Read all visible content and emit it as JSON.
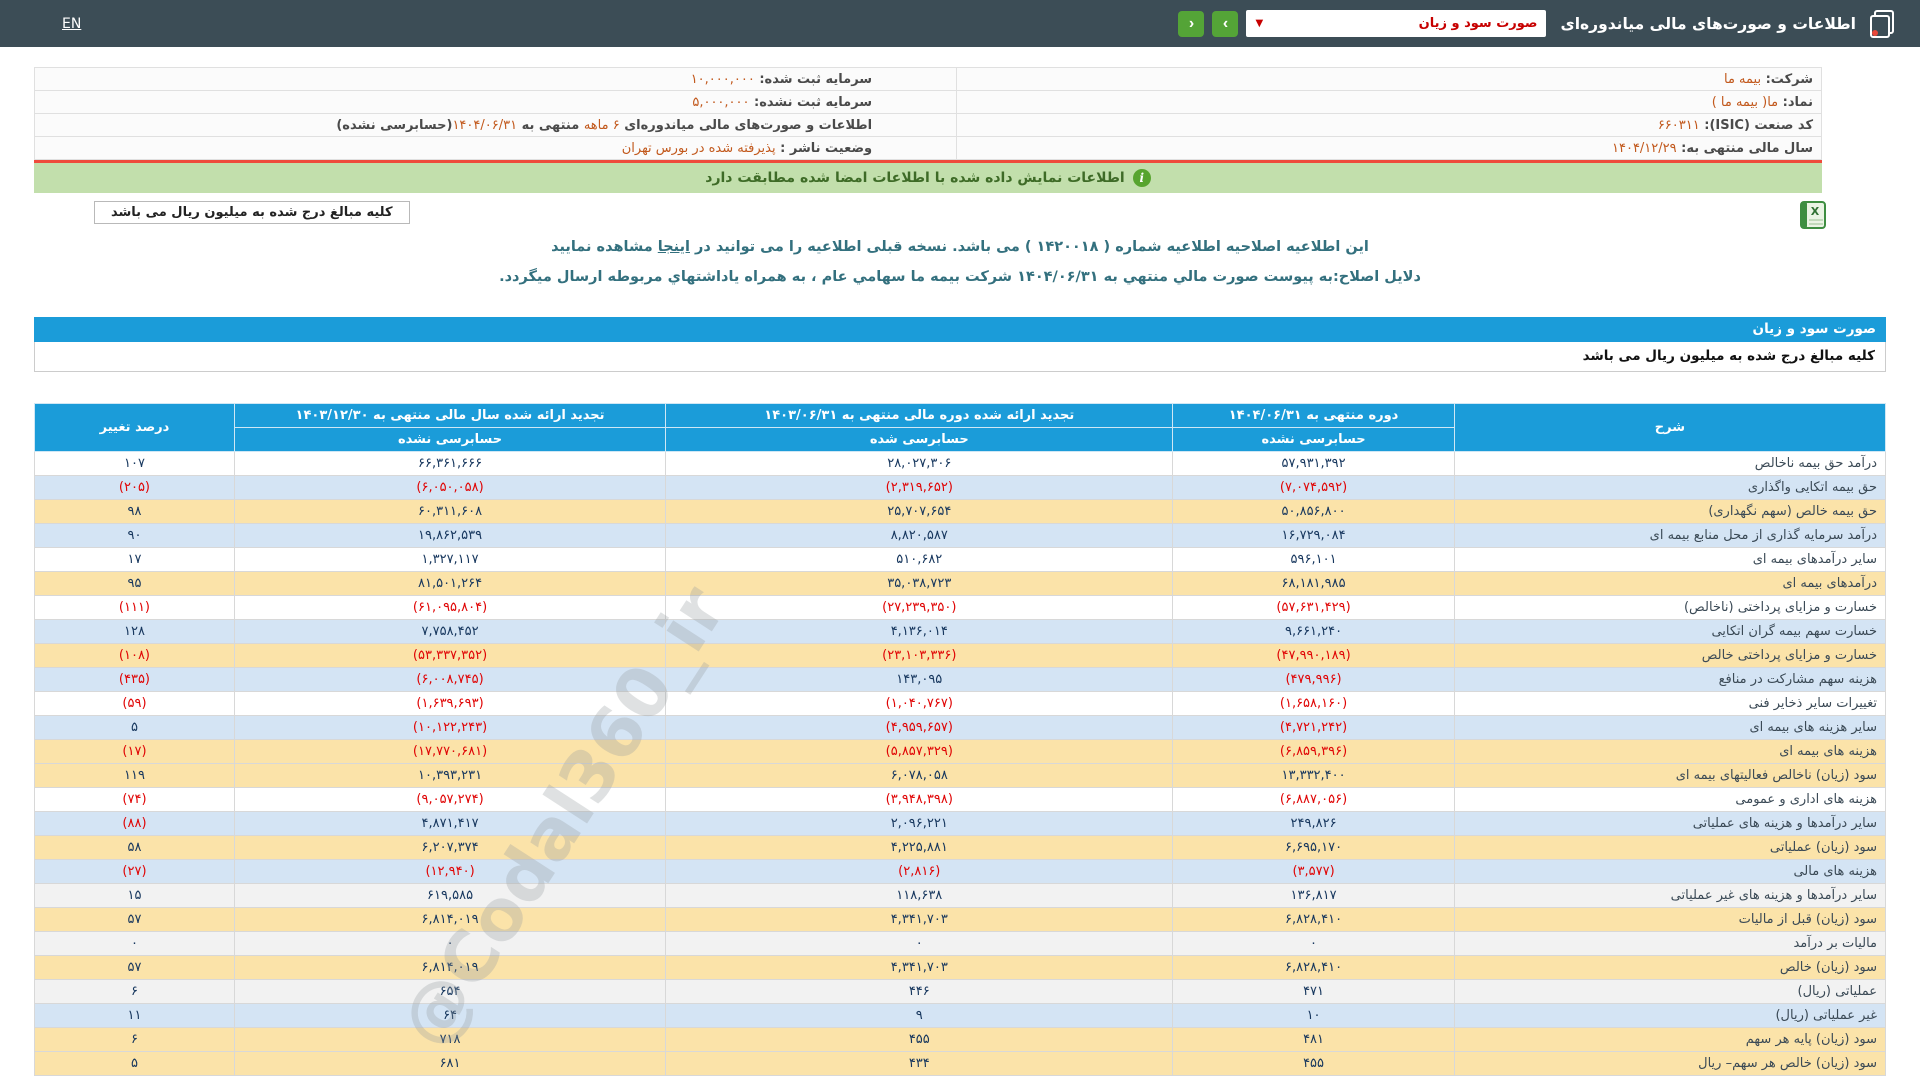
{
  "navbar": {
    "title": "اطلاعات و صورت‌های مالی میاندوره‌ای",
    "report_dropdown_value": "صورت سود و زیان",
    "prev_button": "‹",
    "next_button": "›",
    "lang_link": "EN"
  },
  "company": {
    "rows": [
      {
        "right": {
          "segments": [
            {
              "text": "شرکت:  ",
              "hl": false
            },
            {
              "text": "بیمه ما",
              "hl": true
            }
          ]
        },
        "left": {
          "segments": [
            {
              "text": "سرمایه ثبت شده:  ",
              "hl": false
            },
            {
              "text": "۱۰,۰۰۰,۰۰۰",
              "hl": true
            }
          ]
        }
      },
      {
        "right": {
          "segments": [
            {
              "text": "نماد:  ",
              "hl": false
            },
            {
              "text": "ما( بیمه ما )",
              "hl": true
            }
          ]
        },
        "left": {
          "segments": [
            {
              "text": "سرمایه ثبت نشده:  ",
              "hl": false
            },
            {
              "text": "۵,۰۰۰,۰۰۰",
              "hl": true
            }
          ]
        }
      },
      {
        "right": {
          "segments": [
            {
              "text": "کد صنعت (ISIC):  ",
              "hl": false
            },
            {
              "text": "۶۶۰۳۱۱",
              "hl": true
            }
          ]
        },
        "left": {
          "segments": [
            {
              "text": "اطلاعات و صورت‌های مالی میاندوره‌ای ",
              "hl": false
            },
            {
              "text": "۶ ماهه",
              "hl": true
            },
            {
              "text": " منتهی به ",
              "hl": false
            },
            {
              "text": "۱۴۰۴/۰۶/۳۱",
              "hl": true
            },
            {
              "text": "(حسابرسی نشده)",
              "hl": false
            }
          ]
        }
      },
      {
        "right": {
          "segments": [
            {
              "text": "سال مالی منتهی به:  ",
              "hl": false
            },
            {
              "text": "۱۴۰۴/۱۲/۲۹",
              "hl": true
            }
          ]
        },
        "left": {
          "segments": [
            {
              "text": "وضعیت ناشر :  ",
              "hl": false
            },
            {
              "text": "پذیرفته شده در بورس تهران",
              "hl": true
            }
          ]
        }
      }
    ]
  },
  "signed_notice": "اطلاعات نمایش داده شده با اطلاعات امضا شده مطابقت دارد",
  "unit_note": "کلیه مبالغ درج شده به میلیون ریال می باشد",
  "amendment": {
    "line1_pre": "این اطلاعیه اصلاحیه اطلاعیه شماره ( ۱۴۲۰۰۱۸ ) می باشد. نسخه قبلی اطلاعیه را می توانید در ",
    "line1_link": "اینجا",
    "line1_post": " مشاهده نمایید",
    "line2": "دلایل اصلاح:به پیوست صورت مالي منتهي به ۱۴۰۴/۰۶/۳۱ شرکت بیمه ما سهامي عام ، به همراه یاداشتهاي مربوطه ارسال میگردد."
  },
  "section_title": "صورت سود و زیان",
  "income_statement": {
    "headers": {
      "sharh": "شرح",
      "current": {
        "line1": "دوره منتهی به ۱۴۰۴/۰۶/۳۱",
        "line2": "حسابرسی نشده"
      },
      "prior_period": {
        "line1": "تجدید ارائه شده دوره مالی منتهی به ۱۴۰۳/۰۶/۳۱",
        "line2": "حسابرسی شده"
      },
      "prior_year": {
        "line1": "تجدید ارائه شده سال مالی منتهی به ۱۴۰۳/۱۲/۳۰",
        "line2": "حسابرسی نشده"
      },
      "change_pct": "درصد تغییر"
    },
    "rows": [
      {
        "label": "درآمد حق بیمه ناخالص",
        "current": "۵۷,۹۳۱,۳۹۲",
        "prior_period": "۲۸,۰۲۷,۳۰۶",
        "prior_year": "۶۶,۳۶۱,۶۶۶",
        "change_pct": "۱۰۷",
        "tone": "white"
      },
      {
        "label": "حق بیمه اتکایی واگذاری",
        "current": "(۷,۰۷۴,۵۹۲)",
        "prior_period": "(۲,۳۱۹,۶۵۲)",
        "prior_year": "(۶,۰۵۰,۰۵۸)",
        "change_pct": "(۲۰۵)",
        "tone": "blue"
      },
      {
        "label": "حق بیمه خالص (سهم نگهداری)",
        "current": "۵۰,۸۵۶,۸۰۰",
        "prior_period": "۲۵,۷۰۷,۶۵۴",
        "prior_year": "۶۰,۳۱۱,۶۰۸",
        "change_pct": "۹۸",
        "tone": "yellow"
      },
      {
        "label": "درآمد سرمایه گذاری از محل منابع بیمه ای",
        "current": "۱۶,۷۲۹,۰۸۴",
        "prior_period": "۸,۸۲۰,۵۸۷",
        "prior_year": "۱۹,۸۶۲,۵۳۹",
        "change_pct": "۹۰",
        "tone": "blue"
      },
      {
        "label": "سایر درآمدهای بیمه ای",
        "current": "۵۹۶,۱۰۱",
        "prior_period": "۵۱۰,۶۸۲",
        "prior_year": "۱,۳۲۷,۱۱۷",
        "change_pct": "۱۷",
        "tone": "white"
      },
      {
        "label": "درآمدهای بیمه ای",
        "current": "۶۸,۱۸۱,۹۸۵",
        "prior_period": "۳۵,۰۳۸,۷۲۳",
        "prior_year": "۸۱,۵۰۱,۲۶۴",
        "change_pct": "۹۵",
        "tone": "yellow"
      },
      {
        "label": "خسارت و مزایای پرداختی (ناخالص)",
        "current": "(۵۷,۶۳۱,۴۲۹)",
        "prior_period": "(۲۷,۲۳۹,۳۵۰)",
        "prior_year": "(۶۱,۰۹۵,۸۰۴)",
        "change_pct": "(۱۱۱)",
        "tone": "white"
      },
      {
        "label": "خسارت سهم بیمه گران اتکایی",
        "current": "۹,۶۶۱,۲۴۰",
        "prior_period": "۴,۱۳۶,۰۱۴",
        "prior_year": "۷,۷۵۸,۴۵۲",
        "change_pct": "۱۲۸",
        "tone": "blue"
      },
      {
        "label": "خسارت و مزایای پرداختی خالص",
        "current": "(۴۷,۹۹۰,۱۸۹)",
        "prior_period": "(۲۳,۱۰۳,۳۳۶)",
        "prior_year": "(۵۳,۳۳۷,۳۵۲)",
        "change_pct": "(۱۰۸)",
        "tone": "yellow"
      },
      {
        "label": "هزینه سهم مشارکت در منافع",
        "current": "(۴۷۹,۹۹۶)",
        "prior_period": "۱۴۳,۰۹۵",
        "prior_year": "(۶,۰۰۸,۷۴۵)",
        "change_pct": "(۴۳۵)",
        "tone": "blue"
      },
      {
        "label": "تغییرات سایر ذخایر فنی",
        "current": "(۱,۶۵۸,۱۶۰)",
        "prior_period": "(۱,۰۴۰,۷۶۷)",
        "prior_year": "(۱,۶۳۹,۶۹۳)",
        "change_pct": "(۵۹)",
        "tone": "white"
      },
      {
        "label": "سایر هزینه های بیمه ای",
        "current": "(۴,۷۲۱,۲۴۲)",
        "prior_period": "(۴,۹۵۹,۶۵۷)",
        "prior_year": "(۱۰,۱۲۲,۲۴۳)",
        "change_pct": "۵",
        "tone": "blue"
      },
      {
        "label": "هزینه های بیمه ای",
        "current": "(۶,۸۵۹,۳۹۶)",
        "prior_period": "(۵,۸۵۷,۳۲۹)",
        "prior_year": "(۱۷,۷۷۰,۶۸۱)",
        "change_pct": "(۱۷)",
        "tone": "yellow"
      },
      {
        "label": "سود (زیان) ناخالص فعالیتهای بیمه ای",
        "current": "۱۳,۳۳۲,۴۰۰",
        "prior_period": "۶,۰۷۸,۰۵۸",
        "prior_year": "۱۰,۳۹۳,۲۳۱",
        "change_pct": "۱۱۹",
        "tone": "yellow"
      },
      {
        "label": "هزینه های اداری و عمومی",
        "current": "(۶,۸۸۷,۰۵۶)",
        "prior_period": "(۳,۹۴۸,۳۹۸)",
        "prior_year": "(۹,۰۵۷,۲۷۴)",
        "change_pct": "(۷۴)",
        "tone": "white"
      },
      {
        "label": "سایر درآمدها و هزینه های عملیاتی",
        "current": "۲۴۹,۸۲۶",
        "prior_period": "۲,۰۹۶,۲۲۱",
        "prior_year": "۴,۸۷۱,۴۱۷",
        "change_pct": "(۸۸)",
        "tone": "blue"
      },
      {
        "label": "سود (زیان) عملیاتی",
        "current": "۶,۶۹۵,۱۷۰",
        "prior_period": "۴,۲۲۵,۸۸۱",
        "prior_year": "۶,۲۰۷,۳۷۴",
        "change_pct": "۵۸",
        "tone": "yellow"
      },
      {
        "label": "هزینه های مالی",
        "current": "(۳,۵۷۷)",
        "prior_period": "(۲,۸۱۶)",
        "prior_year": "(۱۲,۹۴۰)",
        "change_pct": "(۲۷)",
        "tone": "blue"
      },
      {
        "label": "سایر درآمدها و هزینه های غیر عملیاتی",
        "current": "۱۳۶,۸۱۷",
        "prior_period": "۱۱۸,۶۳۸",
        "prior_year": "۶۱۹,۵۸۵",
        "change_pct": "۱۵",
        "tone": "gray"
      },
      {
        "label": "سود (زیان) قبل از مالیات",
        "current": "۶,۸۲۸,۴۱۰",
        "prior_period": "۴,۳۴۱,۷۰۳",
        "prior_year": "۶,۸۱۴,۰۱۹",
        "change_pct": "۵۷",
        "tone": "yellow"
      },
      {
        "label": "مالیات بر درآمد",
        "current": "۰",
        "prior_period": "۰",
        "prior_year": "۰",
        "change_pct": "۰",
        "tone": "gray"
      },
      {
        "label": "سود (زیان) خالص",
        "current": "۶,۸۲۸,۴۱۰",
        "prior_period": "۴,۳۴۱,۷۰۳",
        "prior_year": "۶,۸۱۴,۰۱۹",
        "change_pct": "۵۷",
        "tone": "yellow"
      },
      {
        "label": "عملیاتی (ریال)",
        "current": "۴۷۱",
        "prior_period": "۴۴۶",
        "prior_year": "۶۵۴",
        "change_pct": "۶",
        "tone": "gray"
      },
      {
        "label": "غیر عملیاتی (ریال)",
        "current": "۱۰",
        "prior_period": "۹",
        "prior_year": "۶۴",
        "change_pct": "۱۱",
        "tone": "blue"
      },
      {
        "label": "سود (زیان) پایه هر سهم",
        "current": "۴۸۱",
        "prior_period": "۴۵۵",
        "prior_year": "۷۱۸",
        "change_pct": "۶",
        "tone": "yellow"
      },
      {
        "label": "سود (زیان) خالص هر سهم– ریال",
        "current": "۴۵۵",
        "prior_period": "۴۳۴",
        "prior_year": "۶۸۱",
        "change_pct": "۵",
        "tone": "yellow"
      }
    ]
  },
  "watermark": "@Codal360_ir",
  "colors": {
    "accent_blue": "#1B9CD9",
    "row_yellow": "#FBE3A9",
    "row_blue": "#D4E4F4",
    "positive_number": "#17375E",
    "negative_number": "#E00505",
    "value_orange": "#C2591D",
    "navbar": "#3C4D56",
    "green_bar": "#C2DFAC"
  }
}
